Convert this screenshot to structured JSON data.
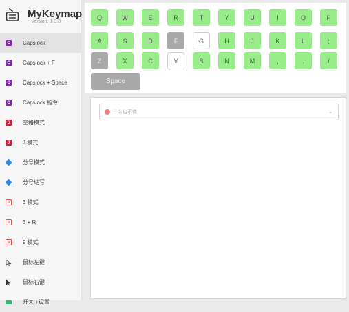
{
  "app": {
    "name": "MyKeymap",
    "version": "version: 1.0.8"
  },
  "sidebar": {
    "items": [
      {
        "label": "Capslock",
        "icon": "purple-square-icon",
        "badge": "C",
        "color": "#7b2fa0"
      },
      {
        "label": "Capslock + F",
        "icon": "purple-square-icon",
        "badge": "C",
        "color": "#7b2fa0"
      },
      {
        "label": "Capslock + Space",
        "icon": "purple-square-icon",
        "badge": "C",
        "color": "#7b2fa0"
      },
      {
        "label": "Capslock 指令",
        "icon": "purple-square-icon",
        "badge": "C",
        "color": "#7b2fa0"
      },
      {
        "label": "空格模式",
        "icon": "red-square-icon",
        "badge": "S",
        "color": "#c9243f"
      },
      {
        "label": "J 模式",
        "icon": "red-square-icon",
        "badge": "J",
        "color": "#c9243f"
      },
      {
        "label": "分号模式",
        "icon": "blue-diamond-icon",
        "color": "#2f8ae6"
      },
      {
        "label": "分号缩写",
        "icon": "blue-diamond-icon",
        "color": "#2f8ae6"
      },
      {
        "label": "3 模式",
        "icon": "red-outline-square-icon",
        "badge": "3",
        "color": "#d9534f"
      },
      {
        "label": "3 + R",
        "icon": "red-outline-square-icon",
        "badge": "3",
        "color": "#d9534f"
      },
      {
        "label": "9 模式",
        "icon": "red-outline-square-icon",
        "badge": "9",
        "color": "#d9534f"
      },
      {
        "label": "鼠标左键",
        "icon": "mouse-pointer-outline-icon",
        "color": "#555555"
      },
      {
        "label": "鼠标右键",
        "icon": "mouse-pointer-filled-icon",
        "color": "#333333"
      },
      {
        "label": "开关 +设置",
        "icon": "green-square-icon",
        "color": "#3cb371"
      }
    ],
    "active_index": 0
  },
  "keyboard": {
    "row1": [
      {
        "label": "Q",
        "state": "green"
      },
      {
        "label": "W",
        "state": "green"
      },
      {
        "label": "E",
        "state": "green"
      },
      {
        "label": "R",
        "state": "green"
      },
      {
        "label": "T",
        "state": "green"
      },
      {
        "label": "Y",
        "state": "green"
      },
      {
        "label": "U",
        "state": "green"
      },
      {
        "label": "I",
        "state": "green"
      },
      {
        "label": "O",
        "state": "green"
      },
      {
        "label": "P",
        "state": "green"
      }
    ],
    "row2": [
      {
        "label": "A",
        "state": "green"
      },
      {
        "label": "S",
        "state": "green"
      },
      {
        "label": "D",
        "state": "green"
      },
      {
        "label": "F",
        "state": "gray"
      },
      {
        "label": "G",
        "state": "white"
      },
      {
        "label": "H",
        "state": "green"
      },
      {
        "label": "J",
        "state": "green"
      },
      {
        "label": "K",
        "state": "green"
      },
      {
        "label": "L",
        "state": "green"
      },
      {
        "label": ";",
        "state": "green"
      }
    ],
    "row3": [
      {
        "label": "Z",
        "state": "gray"
      },
      {
        "label": "X",
        "state": "green"
      },
      {
        "label": "C",
        "state": "green"
      },
      {
        "label": "V",
        "state": "white"
      },
      {
        "label": "B",
        "state": "green"
      },
      {
        "label": "N",
        "state": "green"
      },
      {
        "label": "M",
        "state": "green"
      },
      {
        "label": ",",
        "state": "green"
      },
      {
        "label": ".",
        "state": "green"
      },
      {
        "label": "/",
        "state": "green"
      }
    ],
    "space": {
      "label": "Space",
      "state": "gray"
    }
  },
  "action_select": {
    "value": "什么也不做",
    "icon": "ban-icon"
  },
  "colors": {
    "key_green": "#98ec8a",
    "key_gray": "#a9a9a9",
    "key_white": "#ffffff"
  }
}
